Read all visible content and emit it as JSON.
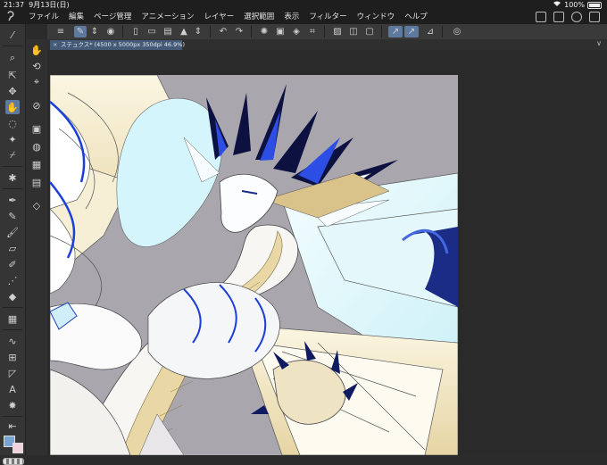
{
  "status_bar": {
    "time": "21:37",
    "date": "9月13日(日)",
    "battery": "100%"
  },
  "menu": {
    "items": [
      "ファイル",
      "編集",
      "ページ管理",
      "アニメーション",
      "レイヤー",
      "選択範囲",
      "表示",
      "フィルター",
      "ウィンドウ",
      "ヘルプ"
    ]
  },
  "tab": {
    "close_label": "×",
    "title": "ステュクス* (4500 x 5000px 350dpi 46.9%)"
  },
  "colors": {
    "main": "#7aa4d6",
    "sub": "#f2d2df",
    "canvas_bg": "#a9a6ad",
    "accent": "#5d7a9e"
  }
}
